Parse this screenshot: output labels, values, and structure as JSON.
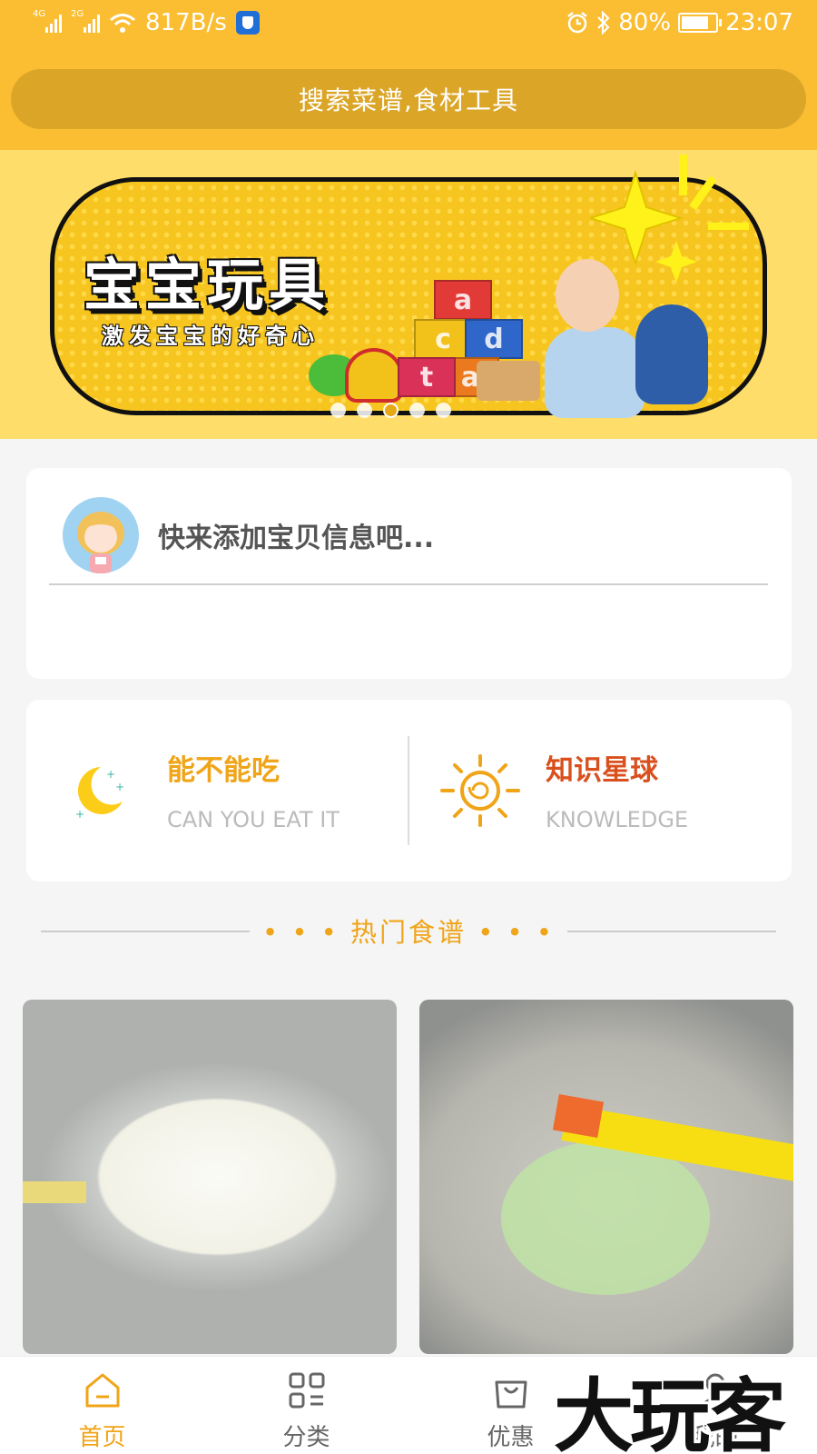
{
  "status_bar": {
    "network_1": "4G",
    "network_2": "2G",
    "speed": "817B/s",
    "battery": "80%",
    "battery_level": 0.8,
    "time": "23:07"
  },
  "search": {
    "placeholder": "搜索菜谱,食材工具"
  },
  "banner": {
    "title": "宝宝玩具",
    "subtitle": "激发宝宝的好奇心",
    "block_letters": [
      "a",
      "c",
      "d",
      "a",
      "t"
    ],
    "slide_count": 5,
    "active_slide": 3
  },
  "baby_info": {
    "prompt": "快来添加宝贝信息吧..."
  },
  "features": [
    {
      "title": "能不能吃",
      "subtitle": "CAN YOU EAT IT",
      "color": "#f0a418",
      "icon": "moon-icon"
    },
    {
      "title": "知识星球",
      "subtitle": "KNOWLEDGE",
      "color": "#d9501e",
      "icon": "sun-icon"
    }
  ],
  "section": {
    "title": "• • •  热门食谱  • • •"
  },
  "recipes": [
    {
      "image": "rice-porridge-photo"
    },
    {
      "image": "vegetable-puree-photo"
    }
  ],
  "tabs": [
    {
      "label": "首页",
      "icon": "home-icon",
      "active": true
    },
    {
      "label": "分类",
      "icon": "category-icon",
      "active": false
    },
    {
      "label": "优惠",
      "icon": "shopping-bag-icon",
      "active": false
    },
    {
      "label": "我的",
      "icon": "profile-icon",
      "active": false
    }
  ],
  "watermark": "大玩客",
  "colors": {
    "brand": "#fbbd32",
    "accent": "#f0a418",
    "knowledge": "#d9501e"
  }
}
